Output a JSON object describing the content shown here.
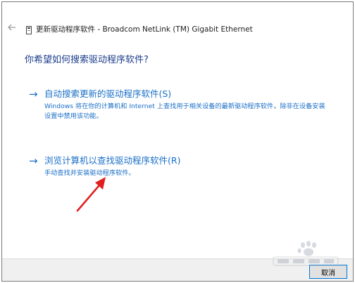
{
  "window": {
    "title": "更新驱动程序软件 - Broadcom NetLink (TM) Gigabit Ethernet"
  },
  "main": {
    "question": "你希望如何搜索驱动程序软件?",
    "options": [
      {
        "arrow": "→",
        "title": "自动搜索更新的驱动程序软件(S)",
        "description": "Windows 将在你的计算机和 Internet 上查找用于相关设备的最新驱动程序软件，除非在设备安装设置中禁用该功能。"
      },
      {
        "arrow": "→",
        "title": "浏览计算机以查找驱动程序软件(R)",
        "description": "手动查找并安装驱动程序软件。"
      }
    ]
  },
  "footer": {
    "cancel_label": "取消"
  },
  "colors": {
    "accent_blue": "#1a6fc7",
    "heading_blue": "#1c3d8c",
    "annotation_red": "#e02020"
  },
  "icons": {
    "back": "back-arrow-icon",
    "device": "network-adapter-icon"
  }
}
